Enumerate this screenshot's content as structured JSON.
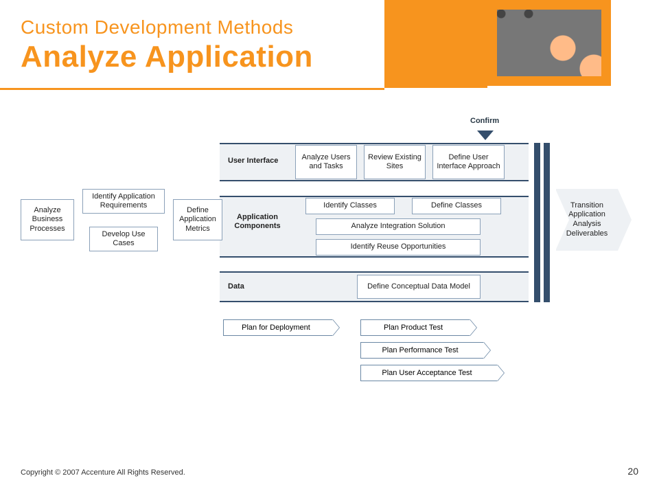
{
  "title": {
    "sub": "Custom Development Methods",
    "main": "Analyze Application"
  },
  "confirm": "Confirm",
  "ui_lane": {
    "header": "User\nInterface",
    "b1": "Analyze Users and Tasks",
    "b2": "Review Existing Sites",
    "b3": "Define User Interface Approach"
  },
  "left": {
    "abp": "Analyze Business Processes",
    "iar": "Identify Application Requirements",
    "duc": "Develop Use Cases",
    "dam": "Define Application Metrics"
  },
  "comp_lane": {
    "header": "Application Components",
    "b1": "Identify Classes",
    "b2": "Define Classes",
    "b3": "Analyze Integration Solution",
    "b4": "Identify Reuse Opportunities"
  },
  "data_lane": {
    "header": "Data",
    "b1": "Define Conceptual Data Model"
  },
  "transition": "Transition Application Analysis Deliverables",
  "plans": {
    "deploy": "Plan for Deployment",
    "product": "Plan Product Test",
    "perf": "Plan Performance Test",
    "uat": "Plan User Acceptance Test"
  },
  "footer": "Copyright © 2007 Accenture All Rights Reserved.",
  "page": "20"
}
